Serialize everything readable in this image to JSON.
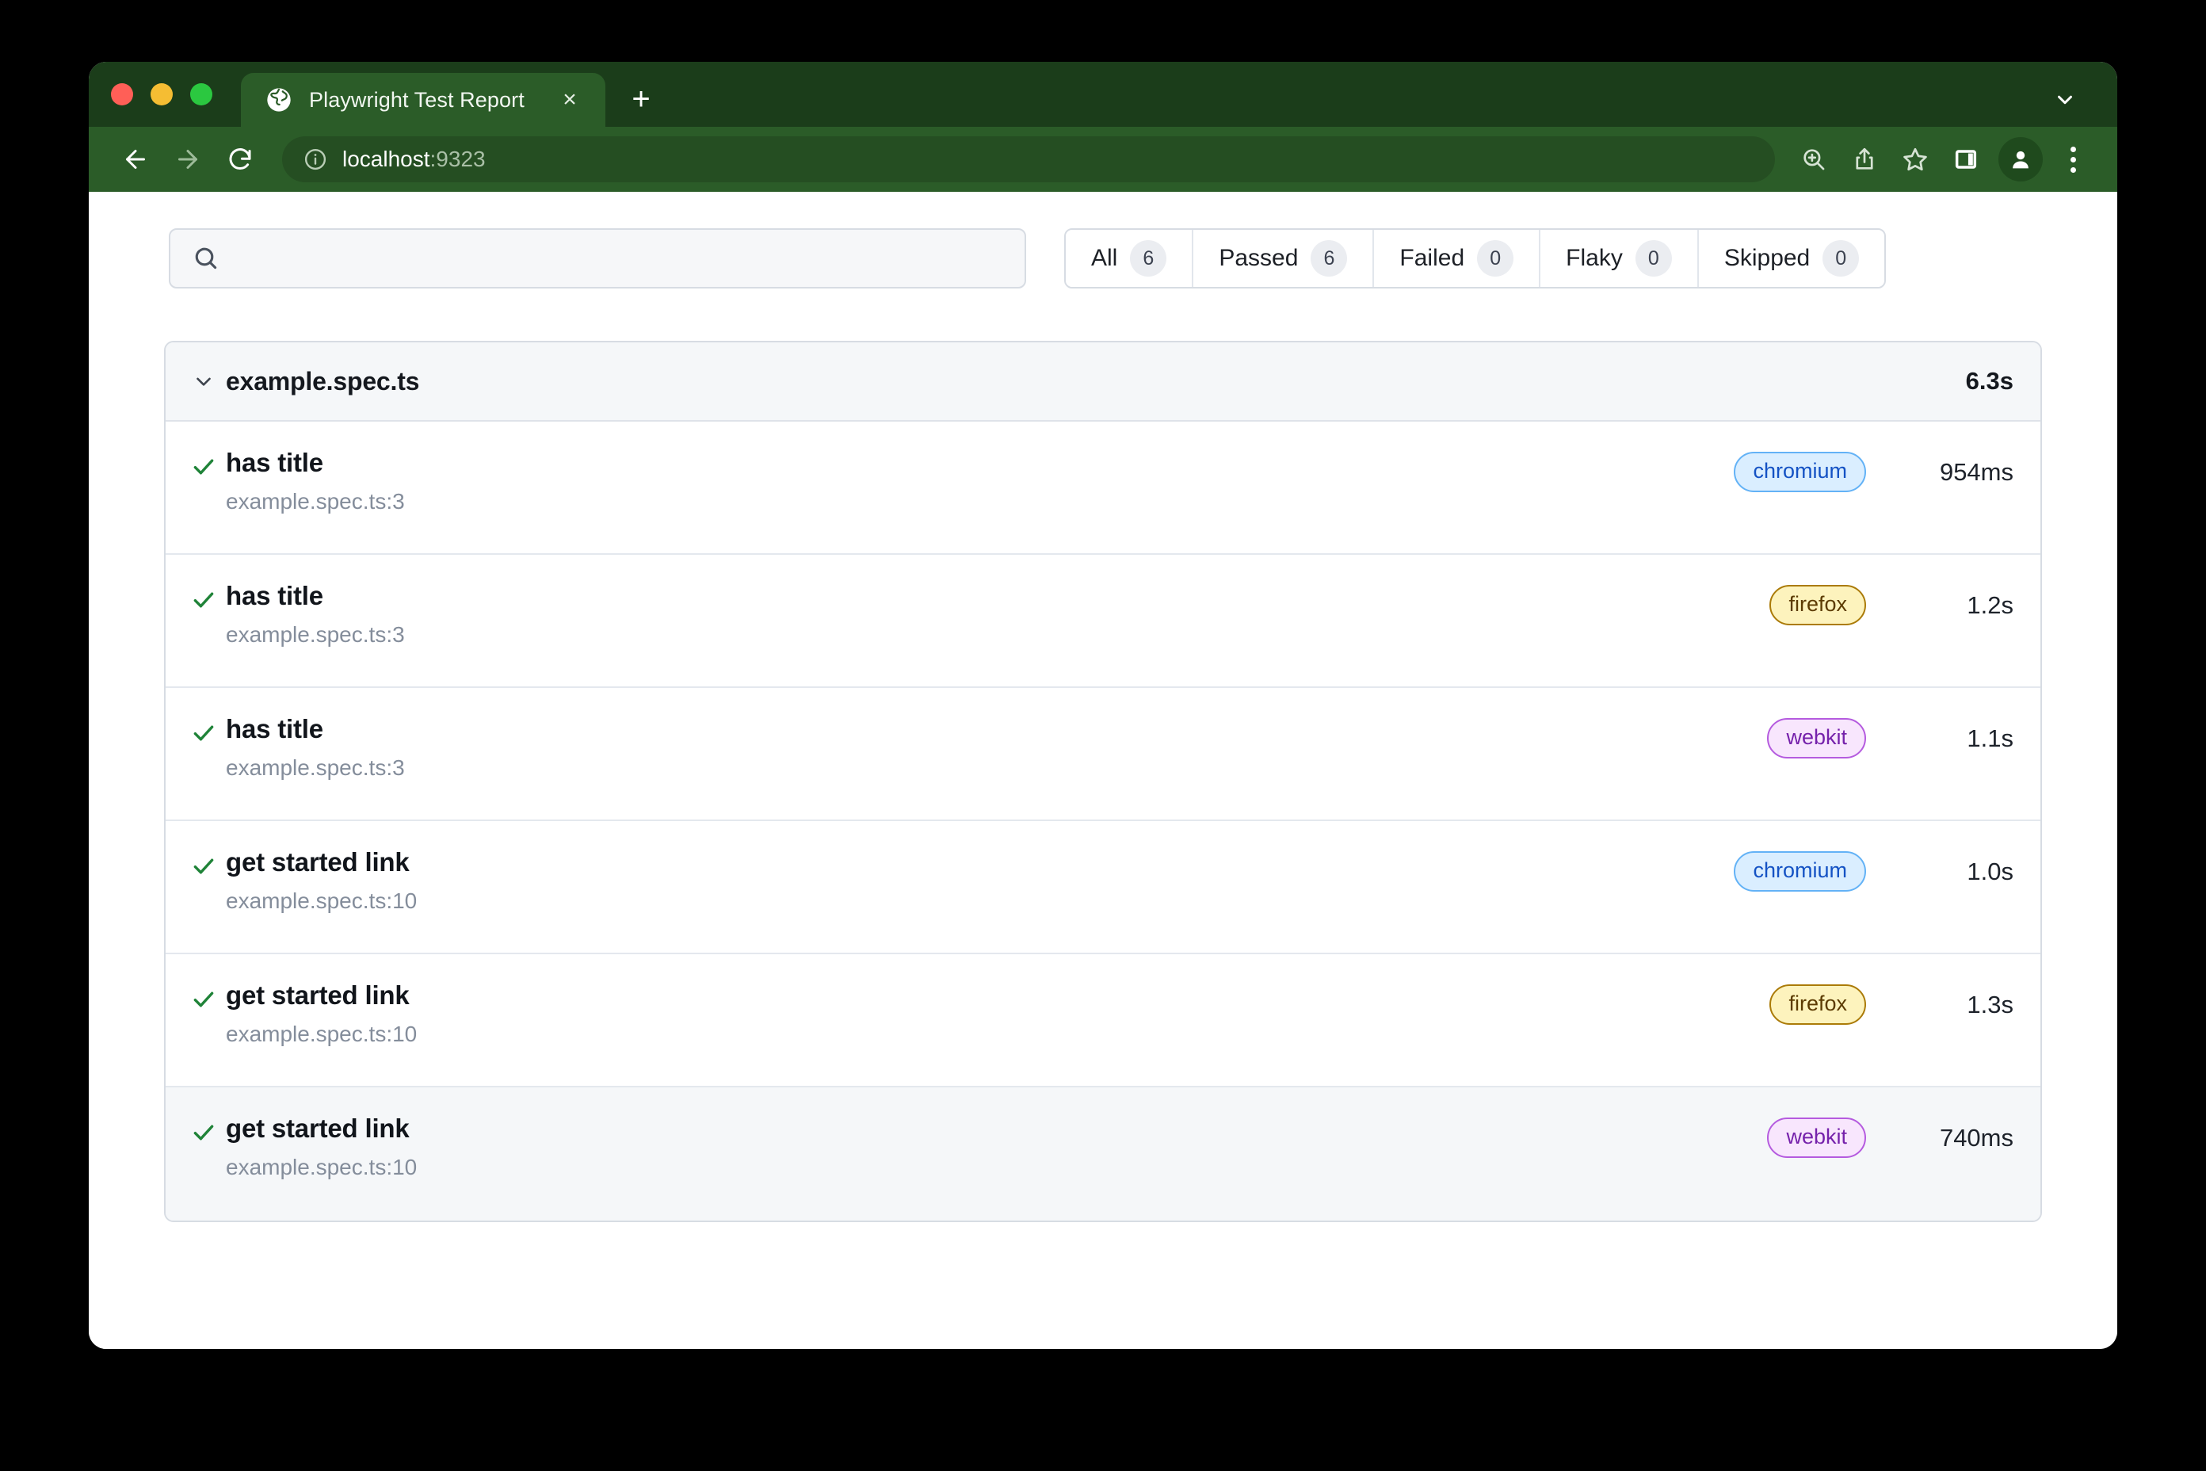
{
  "window": {
    "traffic_lights": [
      "close",
      "minimize",
      "maximize"
    ],
    "chevron_icon": "chevron-down-icon"
  },
  "browser": {
    "tab": {
      "favicon": "globe-icon",
      "title": "Playwright Test Report",
      "close_label": "×"
    },
    "new_tab_label": "+",
    "nav": {
      "back_icon": "arrow-left-icon",
      "forward_icon": "arrow-right-icon",
      "reload_icon": "reload-icon"
    },
    "omnibox": {
      "info_icon": "info-circle-icon",
      "host": "localhost",
      "port": ":9323"
    },
    "toolbar_icons": [
      "zoom-in-icon",
      "share-icon",
      "bookmark-star-icon",
      "side-panel-icon",
      "profile-avatar-icon",
      "more-menu-icon"
    ]
  },
  "search": {
    "icon": "search-icon",
    "value": "",
    "placeholder": ""
  },
  "filters": [
    {
      "label": "All",
      "count": "6"
    },
    {
      "label": "Passed",
      "count": "6"
    },
    {
      "label": "Failed",
      "count": "0"
    },
    {
      "label": "Flaky",
      "count": "0"
    },
    {
      "label": "Skipped",
      "count": "0"
    }
  ],
  "file": {
    "expand_icon": "chevron-down-icon",
    "name": "example.spec.ts",
    "duration": "6.3s"
  },
  "tests": [
    {
      "status_icon": "check-icon",
      "title": "has title",
      "location": "example.spec.ts:3",
      "browser": "chromium",
      "browser_class": "badge-chromium",
      "duration": "954ms",
      "highlighted": false
    },
    {
      "status_icon": "check-icon",
      "title": "has title",
      "location": "example.spec.ts:3",
      "browser": "firefox",
      "browser_class": "badge-firefox",
      "duration": "1.2s",
      "highlighted": false
    },
    {
      "status_icon": "check-icon",
      "title": "has title",
      "location": "example.spec.ts:3",
      "browser": "webkit",
      "browser_class": "badge-webkit",
      "duration": "1.1s",
      "highlighted": false
    },
    {
      "status_icon": "check-icon",
      "title": "get started link",
      "location": "example.spec.ts:10",
      "browser": "chromium",
      "browser_class": "badge-chromium",
      "duration": "1.0s",
      "highlighted": false
    },
    {
      "status_icon": "check-icon",
      "title": "get started link",
      "location": "example.spec.ts:10",
      "browser": "firefox",
      "browser_class": "badge-firefox",
      "duration": "1.3s",
      "highlighted": false
    },
    {
      "status_icon": "check-icon",
      "title": "get started link",
      "location": "example.spec.ts:10",
      "browser": "webkit",
      "browser_class": "badge-webkit",
      "duration": "740ms",
      "highlighted": true
    }
  ],
  "colors": {
    "chrome_tabstrip": "#1b3d1a",
    "chrome_toolbar": "#2b5c28",
    "pass_green": "#1f8338",
    "border": "#d7dce3"
  }
}
